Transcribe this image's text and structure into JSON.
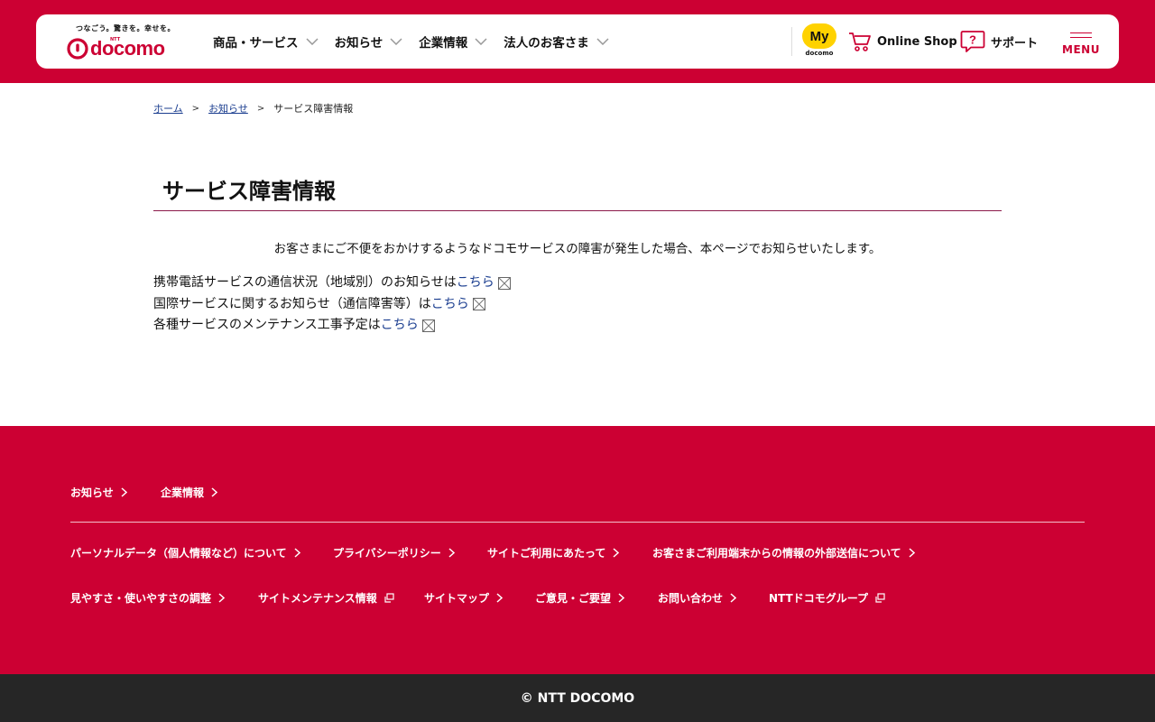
{
  "header": {
    "logo": {
      "tagline": "つなごう。驚きを。幸せを。",
      "ntt": "NTT",
      "wordmark": "docomo"
    },
    "nav": [
      {
        "label": "商品・サービス"
      },
      {
        "label": "お知らせ"
      },
      {
        "label": "企業情報"
      },
      {
        "label": "法人のお客さま"
      }
    ],
    "mydocomo": {
      "main": "My",
      "sub": "docomo"
    },
    "online_shop": "Online Shop",
    "support": "サポート",
    "menu": "MENU"
  },
  "breadcrumb": {
    "home": "ホーム",
    "news": "お知らせ",
    "current": "サービス障害情報",
    "separator": ">"
  },
  "main": {
    "title": "サービス障害情報",
    "intro": "お客さまにご不便をおかけするようなドコモサービスの障害が発生した場合、本ページでお知らせいたします。",
    "items": [
      {
        "text": "携帯電話サービスの通信状況（地域別）のお知らせは",
        "link": "こちら"
      },
      {
        "text": "国際サービスに関するお知らせ（通信障害等）は",
        "link": "こちら"
      },
      {
        "text": "各種サービスのメンテナンス工事予定は",
        "link": "こちら"
      }
    ]
  },
  "footer": {
    "top_links": [
      "お知らせ",
      "企業情報"
    ],
    "row1": [
      "パーソナルデータ（個人情報など）について",
      "プライバシーポリシー",
      "サイトご利用にあたって",
      "お客さまご利用端末からの情報の外部送信について"
    ],
    "row2": [
      {
        "label": "見やすさ・使いやすさの調整",
        "icon": "chevron-right-icon"
      },
      {
        "label": "サイトメンテナンス情報",
        "icon": "external-window-icon"
      },
      {
        "label": "サイトマップ",
        "icon": "chevron-right-icon"
      },
      {
        "label": "ご意見・ご要望",
        "icon": "chevron-right-icon"
      },
      {
        "label": "お問い合わせ",
        "icon": "chevron-right-icon"
      },
      {
        "label": "NTTドコモグループ",
        "icon": "external-window-icon"
      }
    ],
    "copyright": "© NTT DOCOMO"
  },
  "colors": {
    "brand_red": "#cc0033",
    "mydocomo_yellow": "#ffd200",
    "link_blue": "#1a3d8f",
    "copyright_bg": "#262626"
  }
}
